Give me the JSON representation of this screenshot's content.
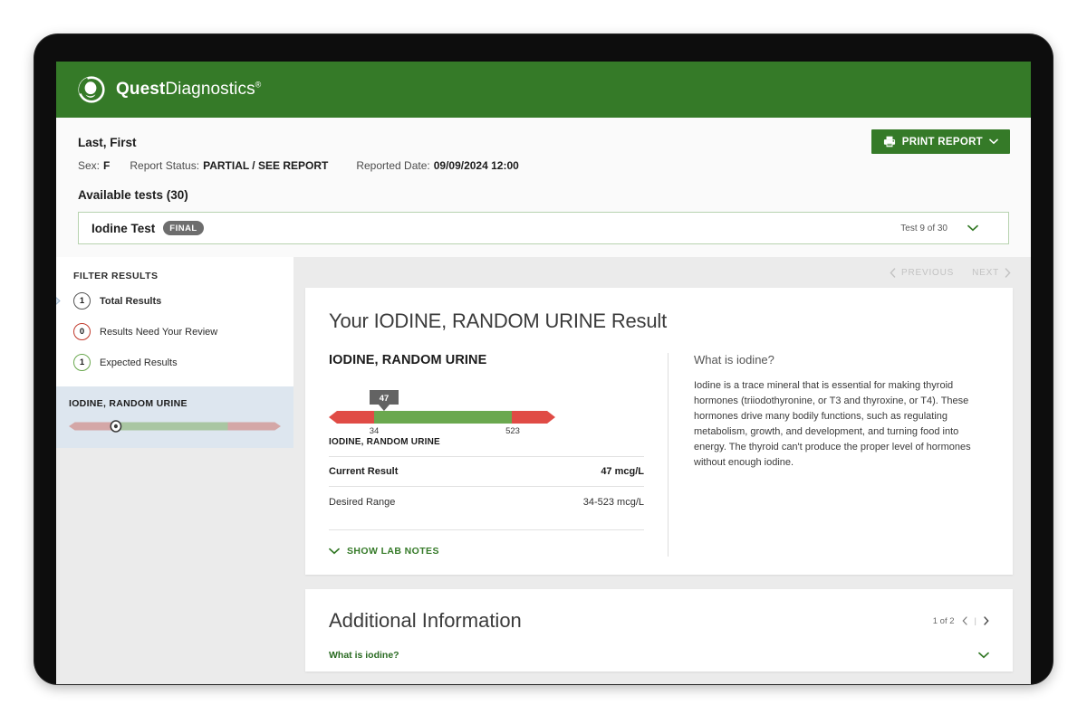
{
  "brand": {
    "name_bold": "Quest",
    "name_light": "Diagnostics",
    "trademark": "®",
    "logo_icon": "quest-swoosh-logo",
    "green": "#357a28"
  },
  "patient": {
    "name": "Last, First",
    "sex_label": "Sex:",
    "sex_value": "F",
    "status_label": "Report Status:",
    "status_value": "PARTIAL / SEE REPORT",
    "reported_label": "Reported Date:",
    "reported_value": "09/09/2024 12:00"
  },
  "toolbar": {
    "print_label": "PRINT REPORT",
    "print_icon": "printer-icon",
    "print_caret_icon": "chevron-down-icon"
  },
  "available": {
    "heading": "Available tests (30)",
    "selected_test": "Iodine Test",
    "status_badge": "FINAL",
    "counter": "Test 9 of 30",
    "caret_icon": "chevron-down-icon"
  },
  "sidebar": {
    "filter_title": "FILTER RESULTS",
    "filters": [
      {
        "count": "1",
        "label": "Total Results",
        "style": "default",
        "active": true
      },
      {
        "count": "0",
        "label": "Results Need Your Review",
        "style": "red",
        "active": false
      },
      {
        "count": "1",
        "label": "Expected Results",
        "style": "green",
        "active": false
      }
    ],
    "selected_result": {
      "name": "IODINE, RANDOM URINE",
      "marker_pct": 22,
      "green_start_pct": 20,
      "green_end_pct": 75
    }
  },
  "nav": {
    "previous": "PREVIOUS",
    "next": "NEXT",
    "prev_icon": "chevron-left-icon",
    "next_icon": "chevron-right-icon"
  },
  "result": {
    "card_title": "Your IODINE, RANDOM URINE Result",
    "analyte": "IODINE, RANDOM URINE",
    "analyte_sub": "IODINE, RANDOM URINE",
    "gauge": {
      "marker_value": "47",
      "low_label": "34",
      "high_label": "523",
      "marker_pct": 24,
      "green_start_pct": 20,
      "green_end_pct": 81,
      "color_green": "#6aa84f",
      "color_red": "#e04b45",
      "color_marker": "#636363"
    },
    "rows": [
      {
        "key": "Current Result",
        "value": "47 mcg/L",
        "strong": true
      },
      {
        "key": "Desired Range",
        "value": "34-523 mcg/L",
        "strong": false
      }
    ],
    "lab_notes_label": "SHOW LAB NOTES",
    "lab_notes_icon": "chevron-down-icon"
  },
  "info_panel": {
    "heading": "What is iodine?",
    "body": "Iodine is a trace mineral that is essential for making thyroid hormones (triiodothyronine, or T3 and thyroxine, or T4). These hormones drive many bodily functions, such as regulating metabolism, growth, and development, and turning food into energy. The thyroid can't produce the proper level of hormones without enough iodine."
  },
  "additional": {
    "title": "Additional Information",
    "pager": "1 of 2",
    "pager_sep": "|",
    "prev_icon": "chevron-left-icon",
    "next_icon": "chevron-right-icon",
    "question": "What is iodine?",
    "caret_icon": "chevron-down-icon"
  }
}
